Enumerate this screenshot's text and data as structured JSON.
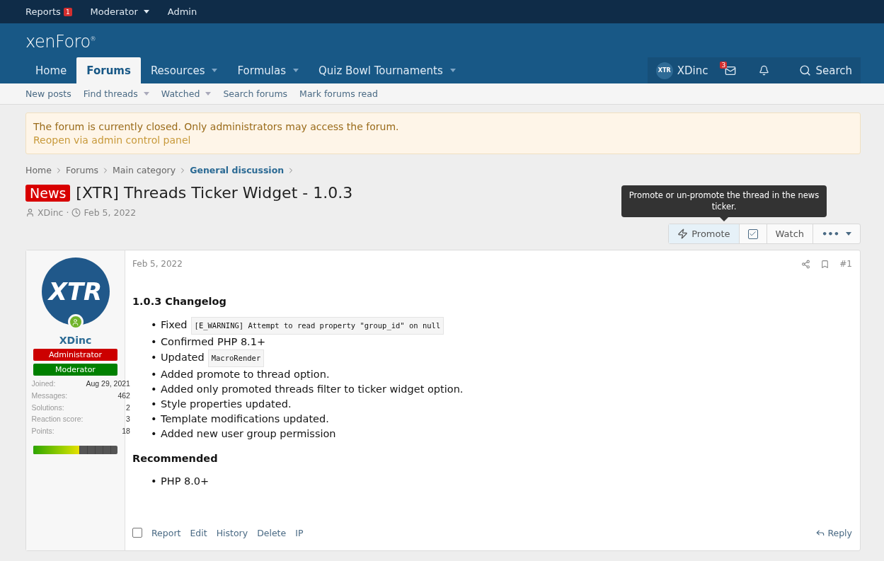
{
  "top_bar": {
    "items": [
      {
        "label": "Reports",
        "badge": "1",
        "has_menu": false
      },
      {
        "label": "Moderator",
        "has_menu": true
      },
      {
        "label": "Admin",
        "has_menu": false
      }
    ]
  },
  "header": {
    "logo": "xenForo",
    "logo_mark": "®"
  },
  "nav": {
    "tabs": [
      {
        "label": "Home",
        "selected": false,
        "has_menu": false
      },
      {
        "label": "Forums",
        "selected": true,
        "has_menu": false
      },
      {
        "label": "Resources",
        "selected": false,
        "has_menu": true
      },
      {
        "label": "Formulas",
        "selected": false,
        "has_menu": true
      },
      {
        "label": "Quiz Bowl Tournaments",
        "selected": false,
        "has_menu": true
      }
    ],
    "user": {
      "name": "XDinc",
      "avatar_text": "XTR"
    },
    "inbox_badge": "3",
    "search": "Search"
  },
  "sub_nav": [
    {
      "label": "New posts",
      "has_menu": false
    },
    {
      "label": "Find threads",
      "has_menu": true
    },
    {
      "label": "Watched",
      "has_menu": true
    },
    {
      "label": "Search forums",
      "has_menu": false
    },
    {
      "label": "Mark forums read",
      "has_menu": false
    }
  ],
  "notice": {
    "message": "The forum is currently closed. Only administrators may access the forum.",
    "link": "Reopen via admin control panel"
  },
  "breadcrumbs": [
    {
      "label": "Home",
      "current": false
    },
    {
      "label": "Forums",
      "current": false
    },
    {
      "label": "Main category",
      "current": false
    },
    {
      "label": "General discussion",
      "current": true
    }
  ],
  "thread": {
    "prefix": "News",
    "title": "[XTR] Threads Ticker Widget - 1.0.3",
    "author": "XDinc",
    "separator": "·",
    "date": "Feb 5, 2022"
  },
  "tooltip": "Promote or un-promote the thread in the news ticker.",
  "actions": {
    "promote": "Promote",
    "watch_checked": true,
    "watch": "Watch",
    "more": "•••"
  },
  "post": {
    "user": {
      "avatar_text": "XTR",
      "online": true,
      "name": "XDinc",
      "banners": [
        {
          "label": "Administrator",
          "color": "#cc0000"
        },
        {
          "label": "Moderator",
          "color": "#008000"
        }
      ],
      "stats": [
        {
          "label": "Joined:",
          "value": "Aug 29, 2021"
        },
        {
          "label": "Messages:",
          "value": "462"
        },
        {
          "label": "Solutions:",
          "value": "2"
        },
        {
          "label": "Reaction score:",
          "value": "3"
        },
        {
          "label": "Points:",
          "value": "18"
        }
      ],
      "level": 0.55
    },
    "date": "Feb 5, 2022",
    "number": "#1",
    "bullet": "•",
    "sections": [
      {
        "heading": "1.0.3 Changelog",
        "items": [
          {
            "text": "Fixed",
            "code": "[E_WARNING] Attempt to read property \"group_id\" on null"
          },
          {
            "text": "Confirmed PHP 8.1+"
          },
          {
            "text": "Updated",
            "code": "MacroRender"
          },
          {
            "text": "Added promote to thread option."
          },
          {
            "text": "Added only promoted threads filter to ticker widget option."
          },
          {
            "text": "Style properties updated."
          },
          {
            "text": "Template modifications updated."
          },
          {
            "text": "Added new user group permission"
          }
        ]
      },
      {
        "heading": "Recommended",
        "items": [
          {
            "text": "PHP 8.0+"
          }
        ]
      }
    ],
    "select_checked": false,
    "footer_links": [
      "Report",
      "Edit",
      "History",
      "Delete",
      "IP"
    ],
    "reply": "Reply"
  }
}
